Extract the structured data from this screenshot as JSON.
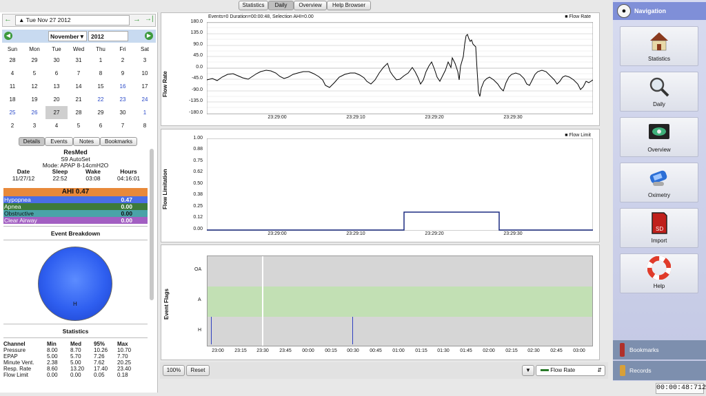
{
  "top_tabs": [
    "Statistics",
    "Daily",
    "Overview",
    "Help Browser"
  ],
  "date_bar": {
    "date": "Tue Nov 27 2012",
    "back_icon": "arrow-left-icon",
    "fwd_icon": "arrow-right-icon",
    "last_icon": "arrow-last-icon"
  },
  "calendar": {
    "month": "November",
    "year": "2012",
    "weekdays": [
      "Sun",
      "Mon",
      "Tue",
      "Wed",
      "Thu",
      "Fri",
      "Sat"
    ],
    "rows": [
      [
        "28",
        "29",
        "30",
        "31",
        "1",
        "2",
        "3"
      ],
      [
        "4",
        "5",
        "6",
        "7",
        "8",
        "9",
        "10"
      ],
      [
        "11",
        "12",
        "13",
        "14",
        "15",
        "16",
        "17"
      ],
      [
        "18",
        "19",
        "20",
        "21",
        "22",
        "23",
        "24"
      ],
      [
        "25",
        "26",
        "27",
        "28",
        "29",
        "30",
        "1"
      ],
      [
        "2",
        "3",
        "4",
        "5",
        "6",
        "7",
        "8"
      ]
    ]
  },
  "side_tabs": [
    "Details",
    "Events",
    "Notes",
    "Bookmarks"
  ],
  "details": {
    "machine": "ResMed",
    "model": "S9 AutoSet",
    "mode": "Mode: APAP 8-14cmH2O",
    "headers": [
      "Date",
      "Sleep",
      "Wake",
      "Hours"
    ],
    "values": [
      "11/27/12",
      "22:52",
      "03:08",
      "04:16:01"
    ],
    "ahi": "AHI 0.47",
    "events": [
      {
        "name": "Hypopnea",
        "value": "0.47",
        "color": "#4a6de5"
      },
      {
        "name": "Apnea",
        "value": "0.00",
        "color": "#3d7a3a"
      },
      {
        "name": "Obstructive",
        "value": "0.00",
        "color": "#4aa3a8"
      },
      {
        "name": "Clear Airway",
        "value": "0.00",
        "color": "#a25fc2"
      }
    ],
    "breakdown_title": "Event Breakdown",
    "pie_label": "H",
    "stats_title": "Statistics",
    "stats_headers": [
      "Channel",
      "Min",
      "Med",
      "95%",
      "Max"
    ],
    "stats_rows": [
      [
        "Pressure",
        "8.00",
        "8.70",
        "10.26",
        "10.70"
      ],
      [
        "EPAP",
        "5.00",
        "5.70",
        "7.26",
        "7.70"
      ],
      [
        "Minute Vent.",
        "2.38",
        "5.00",
        "7.62",
        "20.25"
      ],
      [
        "Resp. Rate",
        "8.60",
        "13.20",
        "17.40",
        "23.40"
      ],
      [
        "Flow Limit",
        "0.00",
        "0.00",
        "0.05",
        "0.18"
      ]
    ]
  },
  "flow_graph": {
    "ylabel": "Flow Rate",
    "header": "Events=0 Duration=00:00:48, Selection AHI=0.00",
    "legend": "Flow Rate",
    "yticks": [
      "180.0",
      "135.0",
      "90.0",
      "45.0",
      "0.0",
      "-45.0",
      "-90.0",
      "-135.0",
      "-180.0"
    ],
    "xticks": [
      "23:29:00",
      "23:29:10",
      "23:29:20",
      "23:29:30"
    ]
  },
  "limit_graph": {
    "ylabel": "Flow Limitation",
    "legend": "Flow Limit",
    "yticks": [
      "1.00",
      "0.88",
      "0.75",
      "0.62",
      "0.50",
      "0.38",
      "0.25",
      "0.12",
      "0.00"
    ],
    "xticks": [
      "23:29:00",
      "23:29:10",
      "23:29:20",
      "23:29:30"
    ]
  },
  "flags_graph": {
    "ylabel": "Event Flags",
    "rows": [
      "OA",
      "A",
      "H"
    ],
    "xticks": [
      "23:00",
      "23:15",
      "23:30",
      "23:45",
      "00:00",
      "00:15",
      "00:30",
      "00:45",
      "01:00",
      "01:15",
      "01:30",
      "01:45",
      "02:00",
      "02:15",
      "02:30",
      "02:45",
      "03:00"
    ]
  },
  "bottom": {
    "zoom": "100%",
    "reset": "Reset",
    "channel": "Flow Rate"
  },
  "nav": {
    "title": "Navigation",
    "items": [
      {
        "label": "Statistics",
        "icon": "house-icon"
      },
      {
        "label": "Daily",
        "icon": "magnifier-icon"
      },
      {
        "label": "Overview",
        "icon": "eye-monitor-icon"
      },
      {
        "label": "Oximetry",
        "icon": "oximeter-icon"
      },
      {
        "label": "Import",
        "icon": "sd-card-icon"
      },
      {
        "label": "Help",
        "icon": "lifebuoy-icon"
      }
    ],
    "bookmarks": "Bookmarks",
    "records": "Records"
  },
  "clock": "00:00:48:712",
  "colors": {
    "accent": "#7f8fd8",
    "orange": "#e8893a",
    "pie": "#2f5ff0"
  }
}
